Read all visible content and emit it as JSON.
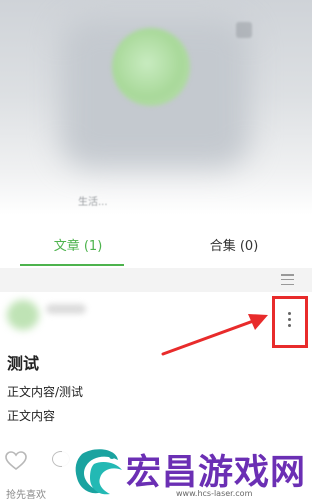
{
  "profile": {
    "subtitle": "生活..."
  },
  "tabs": [
    {
      "label": "文章 (1)",
      "active": true
    },
    {
      "label": "合集 (0)",
      "active": false
    }
  ],
  "post": {
    "title": "测试",
    "lines": [
      "正文内容/测试",
      "正文内容"
    ],
    "like_text": "抢先喜欢"
  },
  "watermark": {
    "title": "宏昌游戏网",
    "url": "www.hcs-laser.com"
  },
  "icons": [
    "menu-icon",
    "more-vertical-icon",
    "heart-icon",
    "comment-icon",
    "watermark-logo-icon"
  ],
  "colors": {
    "accent": "#4db34d",
    "highlight": "#e82b2b",
    "watermark": "#6b2fb4"
  }
}
